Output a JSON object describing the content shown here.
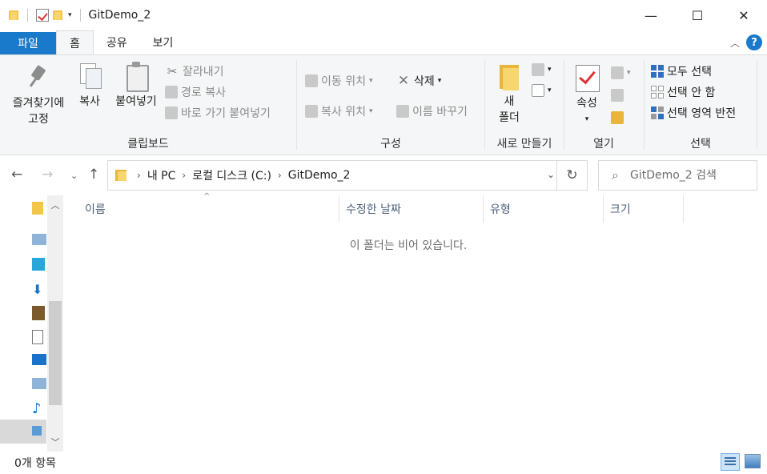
{
  "window": {
    "title": "GitDemo_2",
    "controls": {
      "minimize": "—",
      "maximize": "☐",
      "close": "✕"
    }
  },
  "tabs": {
    "file": "파일",
    "items": [
      {
        "label": "홈",
        "active": true
      },
      {
        "label": "공유",
        "active": false
      },
      {
        "label": "보기",
        "active": false
      }
    ],
    "help": "?"
  },
  "ribbon": {
    "clipboard": {
      "label": "클립보드",
      "pin_line1": "즐겨찾기에",
      "pin_line2": "고정",
      "copy": "복사",
      "paste": "붙여넣기",
      "cut": "잘라내기",
      "copy_path": "경로 복사",
      "paste_shortcut": "바로 가기 붙여넣기"
    },
    "organize": {
      "label": "구성",
      "move_to": "이동 위치",
      "copy_to": "복사 위치",
      "delete": "삭제",
      "rename": "이름 바꾸기"
    },
    "new": {
      "label": "새로 만들기",
      "new_folder_line1": "새",
      "new_folder_line2": "폴더"
    },
    "open": {
      "label": "열기",
      "properties": "속성"
    },
    "select": {
      "label": "선택",
      "select_all": "모두 선택",
      "select_none": "선택 안 함",
      "invert": "선택 영역 반전"
    }
  },
  "address": {
    "crumbs": [
      "내 PC",
      "로컬 디스크 (C:)",
      "GitDemo_2"
    ],
    "search_placeholder": "GitDemo_2 검색"
  },
  "columns": [
    "이름",
    "수정한 날짜",
    "유형",
    "크기"
  ],
  "empty_message": "이 폴더는 비어 있습니다.",
  "status": {
    "item_count": "0개 항목"
  }
}
